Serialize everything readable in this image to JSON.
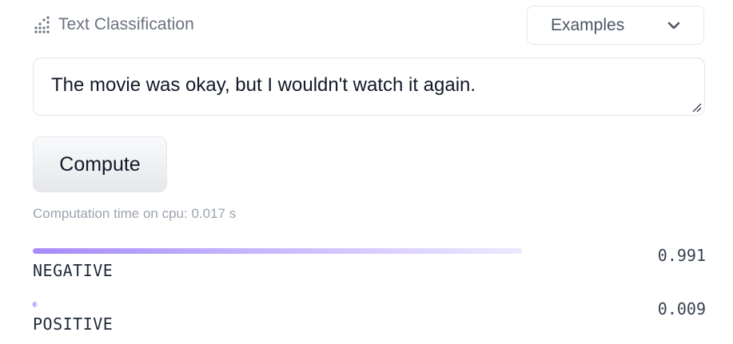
{
  "header": {
    "title": "Text Classification",
    "icon": "text-classification-icon"
  },
  "examples": {
    "label": "Examples",
    "icon": "chevron-down-icon"
  },
  "input": {
    "value": "The movie was okay, but I wouldn't watch it again."
  },
  "compute": {
    "label": "Compute"
  },
  "status": {
    "computation_time": "Computation time on cpu: 0.017 s"
  },
  "results": [
    {
      "label": "NEGATIVE",
      "score": "0.991",
      "bar_fraction": 0.727
    },
    {
      "label": "POSITIVE",
      "score": "0.009",
      "bar_fraction": 0.007
    }
  ],
  "colors": {
    "bar_start": "#a78bfa",
    "bar_end": "#ede9fe",
    "muted_text": "#9ca3af"
  }
}
